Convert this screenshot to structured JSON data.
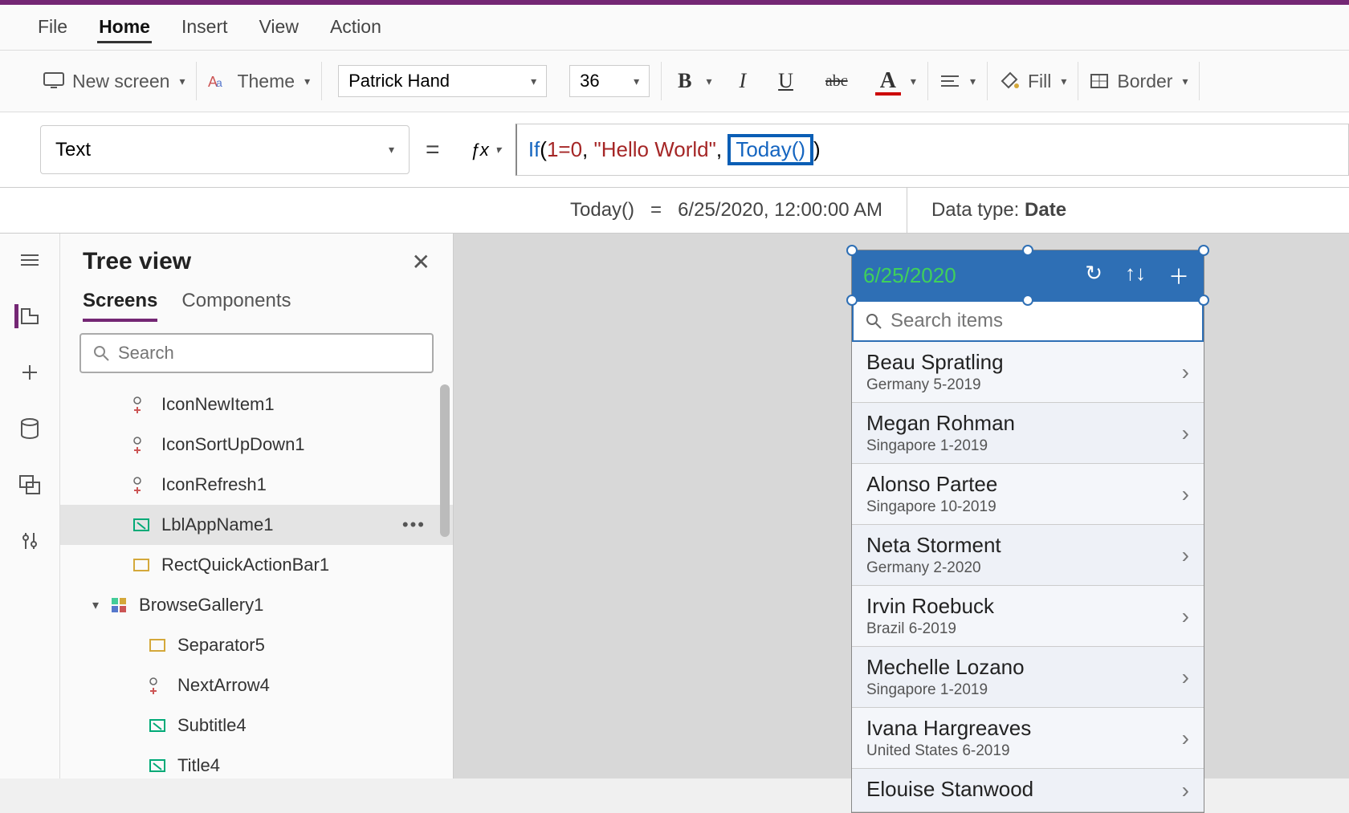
{
  "menu": {
    "file": "File",
    "home": "Home",
    "insert": "Insert",
    "view": "View",
    "action": "Action"
  },
  "ribbon": {
    "new_screen": "New screen",
    "theme": "Theme",
    "font_name": "Patrick Hand",
    "font_size": "36",
    "fill": "Fill",
    "border": "Border"
  },
  "property_select": "Text",
  "formula": {
    "if": "If",
    "cond": "1=0",
    "str": "\"Hello World\"",
    "fn": "Today()",
    "close": ")"
  },
  "result": {
    "expr": "Today()",
    "eq": "=",
    "val": "6/25/2020, 12:00:00 AM",
    "type_label": "Data type:",
    "type": "Date"
  },
  "tree": {
    "title": "Tree view",
    "tab_screens": "Screens",
    "tab_components": "Components",
    "search_ph": "Search",
    "items": [
      {
        "label": "IconNewItem1"
      },
      {
        "label": "IconSortUpDown1"
      },
      {
        "label": "IconRefresh1"
      },
      {
        "label": "LblAppName1"
      },
      {
        "label": "RectQuickActionBar1"
      },
      {
        "label": "BrowseGallery1"
      },
      {
        "label": "Separator5"
      },
      {
        "label": "NextArrow4"
      },
      {
        "label": "Subtitle4"
      },
      {
        "label": "Title4"
      }
    ]
  },
  "phone": {
    "header_date": "6/25/2020",
    "search_ph": "Search items",
    "rows": [
      {
        "name": "Beau Spratling",
        "sub": "Germany 5-2019"
      },
      {
        "name": "Megan Rohman",
        "sub": "Singapore 1-2019"
      },
      {
        "name": "Alonso Partee",
        "sub": "Singapore 10-2019"
      },
      {
        "name": "Neta Storment",
        "sub": "Germany 2-2020"
      },
      {
        "name": "Irvin Roebuck",
        "sub": "Brazil 6-2019"
      },
      {
        "name": "Mechelle Lozano",
        "sub": "Singapore 1-2019"
      },
      {
        "name": "Ivana Hargreaves",
        "sub": "United States 6-2019"
      },
      {
        "name": "Elouise Stanwood",
        "sub": ""
      }
    ]
  }
}
